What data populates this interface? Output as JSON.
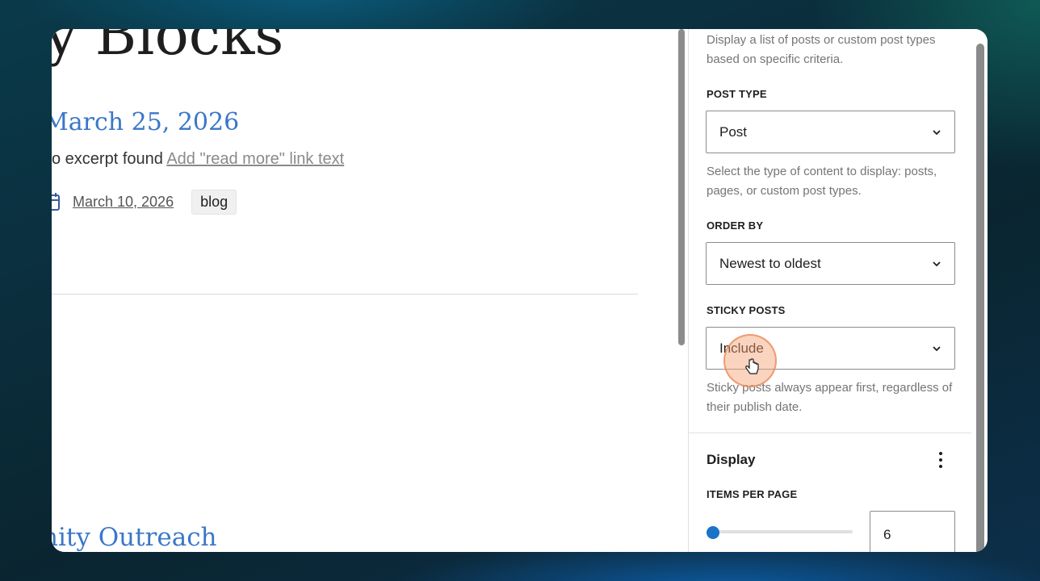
{
  "canvas": {
    "heading_fragment": "y Blocks",
    "post_title": "March 25, 2026",
    "excerpt_text": "o excerpt found",
    "read_more_link": "Add \"read more\" link text",
    "meta_date": "March 10, 2026",
    "meta_tag": "blog",
    "next_post_title": "nity Outreach"
  },
  "sidebar": {
    "description": "Display a list of posts or custom post types based on specific criteria.",
    "post_type": {
      "label": "POST TYPE",
      "value": "Post",
      "help": "Select the type of content to display: posts, pages, or custom post types."
    },
    "order_by": {
      "label": "ORDER BY",
      "value": "Newest to oldest"
    },
    "sticky_posts": {
      "label": "STICKY POSTS",
      "value": "Include",
      "help": "Sticky posts always appear first, regardless of their publish date."
    },
    "display_panel": {
      "title": "Display",
      "items_per_page_label": "ITEMS PER PAGE",
      "items_per_page_value": "6"
    }
  },
  "colors": {
    "link_blue": "#3a77c9",
    "accent": "#1a73c7",
    "cursor_highlight": "#f4a06e"
  },
  "icons": [
    "calendar-icon",
    "chevron-down-icon",
    "more-vertical-icon",
    "hand-pointer-icon"
  ]
}
